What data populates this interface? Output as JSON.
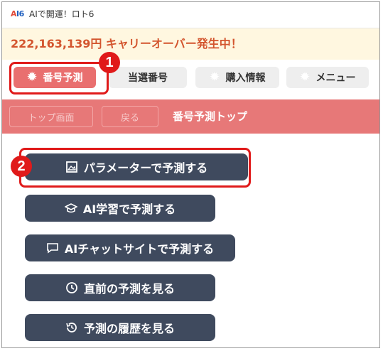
{
  "window": {
    "logo_text": "AI6",
    "title": "AIで開運！ロト6"
  },
  "banner": {
    "carryover_text": "222,163,139円 キャリーオーバー発生中！"
  },
  "tabs": [
    {
      "label": "番号予測",
      "active": true,
      "icon": "burst-icon"
    },
    {
      "label": "当選番号",
      "active": false,
      "icon": null
    },
    {
      "label": "購入情報",
      "active": false,
      "icon": "burst-icon"
    },
    {
      "label": "メニュー",
      "active": false,
      "icon": "burst-icon"
    }
  ],
  "subheader": {
    "top_label": "トップ画面",
    "back_label": "戻る",
    "title": "番号予測トップ"
  },
  "actions": [
    {
      "label": "パラメーターで予測する",
      "icon": "image-frame-icon"
    },
    {
      "label": "AI学習で予測する",
      "icon": "graduation-cap-icon"
    },
    {
      "label": "AIチャットサイトで予測する",
      "icon": "chat-bubble-icon"
    },
    {
      "label": "直前の予測を見る",
      "icon": "clock-icon"
    },
    {
      "label": "予測の履歴を見る",
      "icon": "history-icon"
    }
  ],
  "callouts": [
    {
      "number": "1"
    },
    {
      "number": "2"
    }
  ],
  "colors": {
    "accent_red": "#e77878",
    "button_navy": "#3f4a5e",
    "banner_bg": "#fff7e0",
    "banner_text": "#d3552e",
    "callout_red": "#e01a1a"
  }
}
